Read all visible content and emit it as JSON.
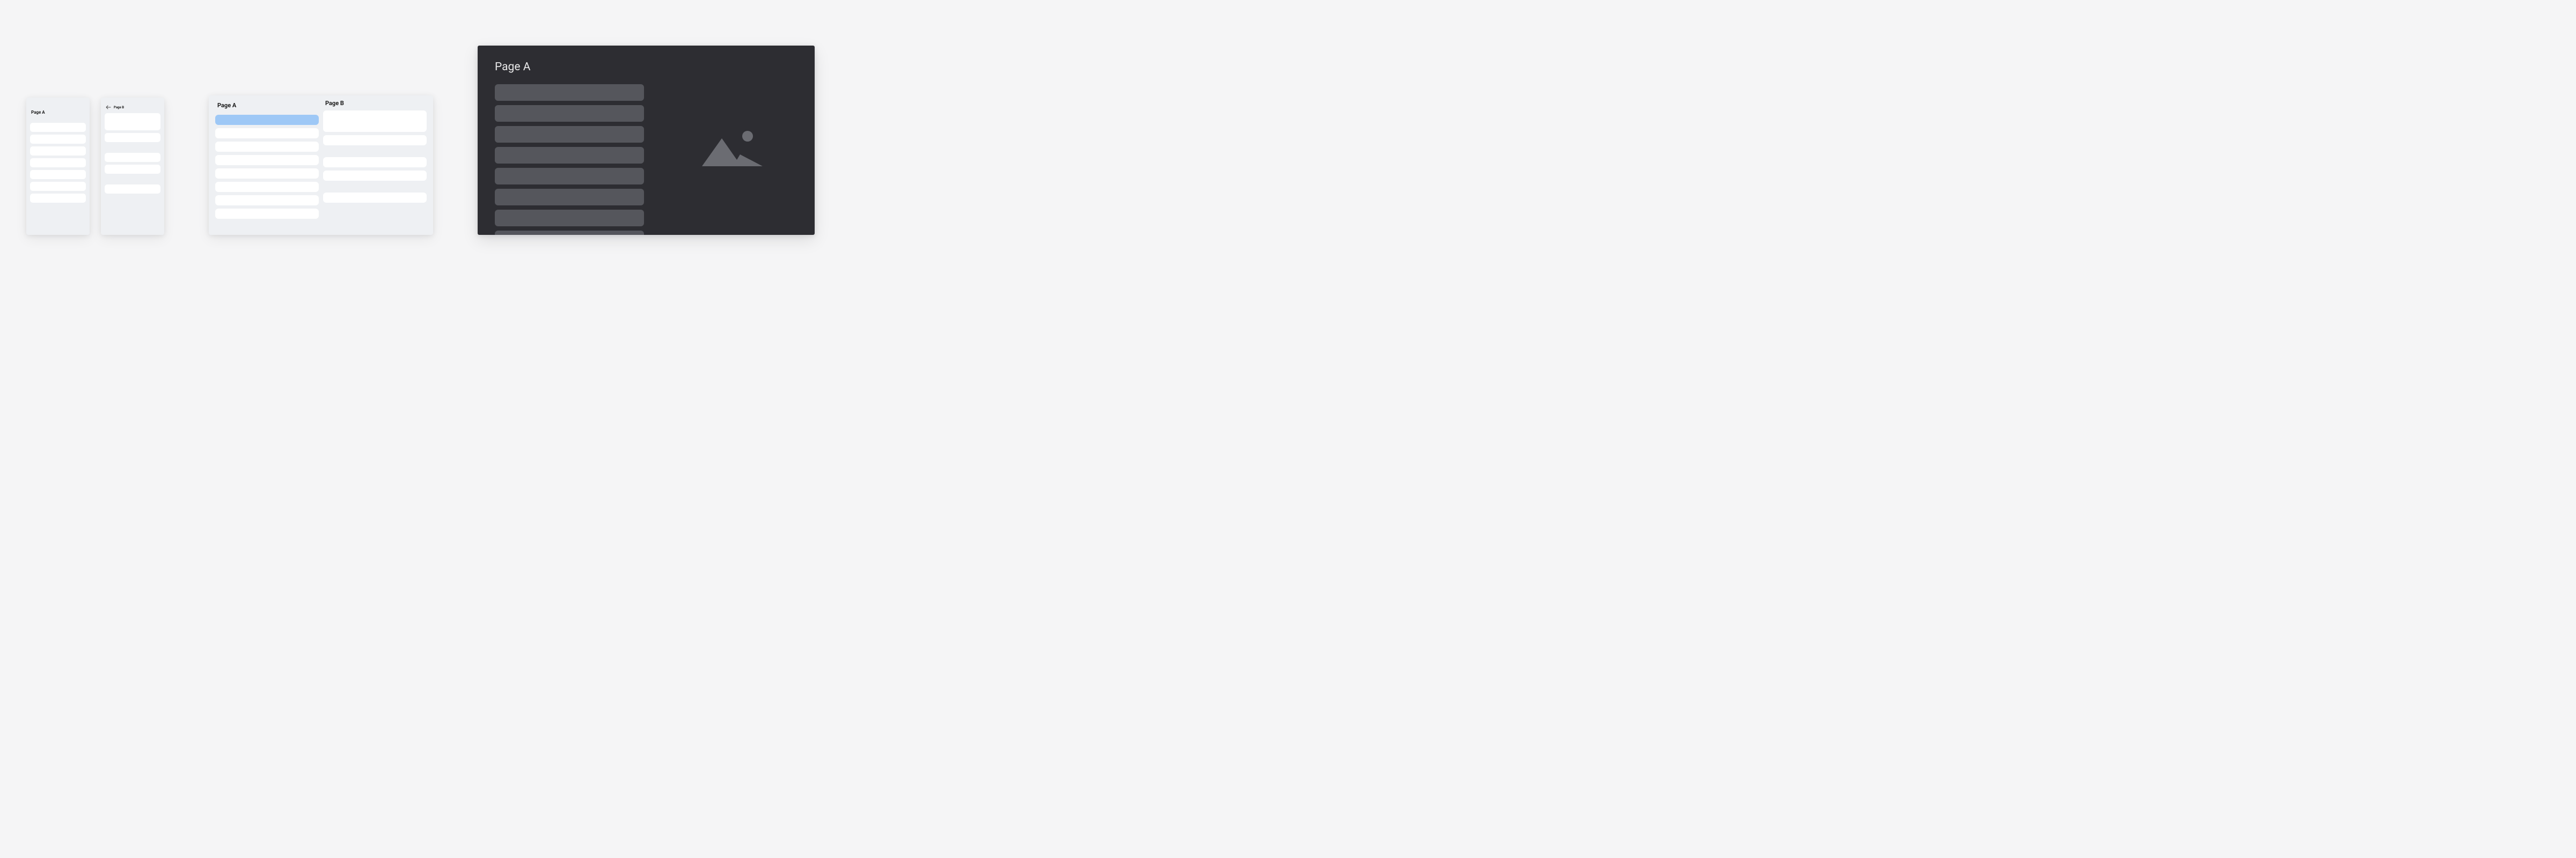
{
  "layouts": {
    "phone_a": {
      "title": "Page A",
      "items": 7
    },
    "phone_b": {
      "title": "Page B",
      "groups": [
        2,
        2,
        1
      ]
    },
    "tablet": {
      "left": {
        "title": "Page A",
        "items": 8,
        "selected_index": 0
      },
      "right": {
        "title": "Page B",
        "groups": [
          2,
          2,
          1
        ]
      }
    },
    "desktop": {
      "title": "Page A",
      "items": 8,
      "image_icon": "image-placeholder-icon"
    }
  },
  "colors": {
    "page_bg": "#f5f5f6",
    "panel_light": "#eef0f3",
    "item_light": "#ffffff",
    "item_selected": "#9ec8f6",
    "panel_dark": "#2d2d32",
    "item_dark": "#55565c",
    "text_dark": "#1a1a1a",
    "text_light": "#e8e8e9",
    "icon_muted": "#6b6c72"
  }
}
